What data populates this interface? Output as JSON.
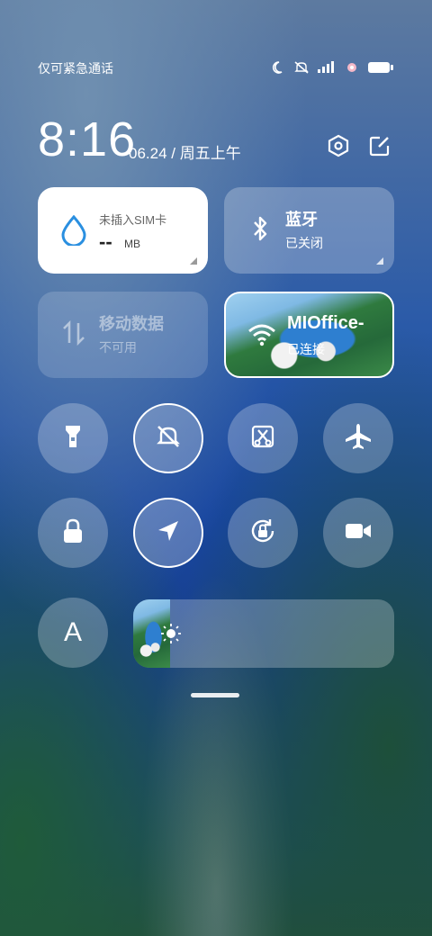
{
  "status_bar": {
    "carrier_text": "仅可紧急通话",
    "icons": [
      "moon-icon",
      "mute-icon",
      "signal-icon",
      "flower-icon",
      "battery-icon"
    ]
  },
  "header": {
    "time": "8:16",
    "date": "06.24 / 周五上午"
  },
  "tiles": {
    "data_usage": {
      "title": "未插入SIM卡",
      "value": "--",
      "unit": "MB"
    },
    "bluetooth": {
      "title": "蓝牙",
      "status": "已关闭"
    },
    "mobile_data": {
      "title": "移动数据",
      "status": "不可用"
    },
    "wifi": {
      "title": "MIOffice-",
      "status": "已连接"
    }
  },
  "toggles": {
    "row1": [
      "flashlight",
      "mute",
      "screenshot",
      "airplane"
    ],
    "row2": [
      "lock",
      "location",
      "rotation-lock",
      "screen-record"
    ],
    "auto_brightness_label": "A"
  },
  "brightness": {
    "level": 0.14
  },
  "colors": {
    "tile_white": "#ffffff",
    "accent_blue": "#2a8fe0"
  }
}
